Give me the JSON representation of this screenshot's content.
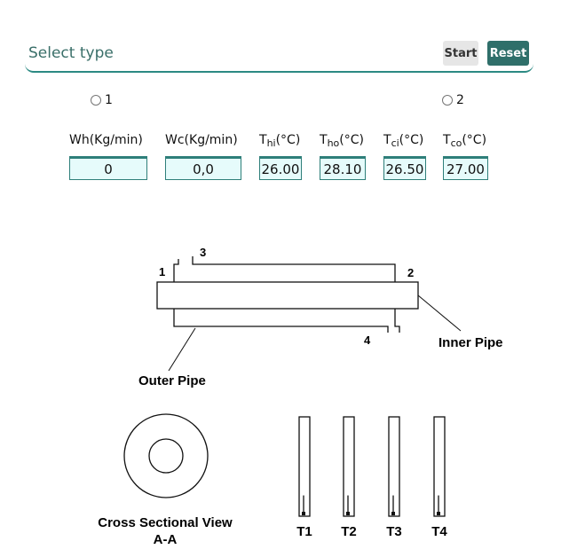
{
  "header": {
    "title": "Select type",
    "start_label": "Start",
    "reset_label": "Reset"
  },
  "type_options": [
    {
      "label": "1"
    },
    {
      "label": "2"
    }
  ],
  "columns": [
    {
      "name": "Wh",
      "sub": "",
      "unit": "(Kg/min)",
      "value": "0"
    },
    {
      "name": "Wc",
      "sub": "",
      "unit": "(Kg/min)",
      "value": "0,0"
    },
    {
      "name": "T",
      "sub": "hi",
      "unit": "(°C)",
      "value": "26.00"
    },
    {
      "name": "T",
      "sub": "ho",
      "unit": "(°C)",
      "value": "28.10"
    },
    {
      "name": "T",
      "sub": "ci",
      "unit": "(°C)",
      "value": "26.50"
    },
    {
      "name": "T",
      "sub": "co",
      "unit": "(°C)",
      "value": "27.00"
    }
  ],
  "diagram": {
    "port_labels": [
      "1",
      "2",
      "3",
      "4"
    ],
    "inner_pipe_label": "Inner Pipe",
    "outer_pipe_label": "Outer Pipe",
    "cross_section_label_line1": "Cross Sectional View",
    "cross_section_label_line2": "A-A",
    "thermometers": [
      {
        "label": "T1",
        "level": 0.12
      },
      {
        "label": "T2",
        "level": 0.12
      },
      {
        "label": "T3",
        "level": 0.12
      },
      {
        "label": "T4",
        "level": 0.12
      }
    ]
  }
}
